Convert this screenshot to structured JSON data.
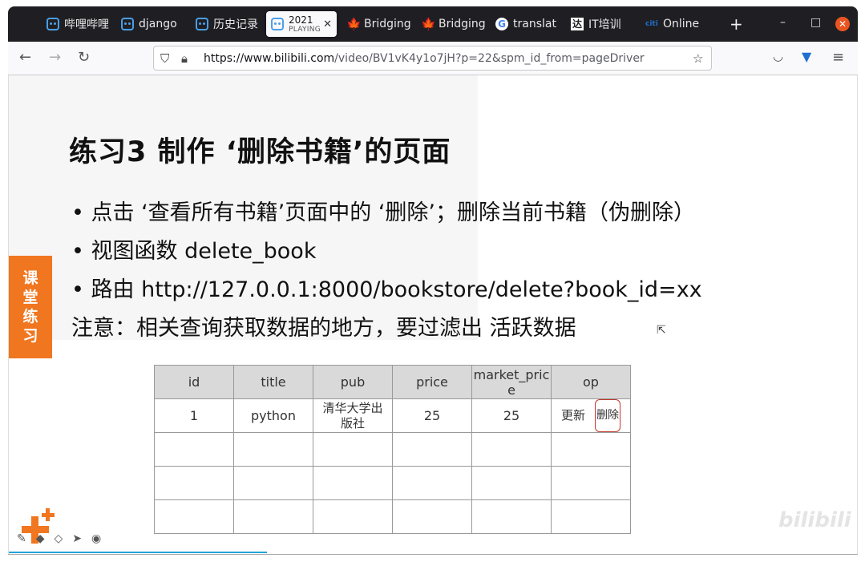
{
  "browser": {
    "tabs": [
      {
        "label": "哔哩哔哩",
        "icon": "bilibili-icon"
      },
      {
        "label": "django",
        "icon": "bilibili-icon"
      },
      {
        "label": "历史记录",
        "icon": "bilibili-icon"
      },
      {
        "label": "2021",
        "sub": "PLAYING",
        "icon": "bilibili-icon",
        "active": true
      },
      {
        "label": "Bridging",
        "icon": "maple-leaf-icon"
      },
      {
        "label": "Bridging",
        "icon": "maple-leaf-icon"
      },
      {
        "label": "translat",
        "icon": "google-icon"
      },
      {
        "label": "IT培训",
        "icon": "it-icon"
      },
      {
        "label": "Online",
        "icon": "citi-icon"
      }
    ],
    "new_tab": "+",
    "window_controls": {
      "minimize": "–",
      "maximize": "□",
      "close": "✕"
    },
    "url_host": "https://www.bilibili.com",
    "url_path": "/video/BV1vK4y1o7jH?p=22&spm_id_from=pageDriver"
  },
  "slide": {
    "title": "练习3 制作 ‘删除书籍’的页面",
    "side_tab": [
      "课",
      "堂",
      "练",
      "习"
    ],
    "bullets": [
      "• 点击 ‘查看所有书籍’页面中的 ‘删除’；删除当前书籍（伪删除）",
      "• 视图函数 delete_book",
      "• 路由 http://127.0.0.1:8000/bookstore/delete?book_id=xx",
      "注意：相关查询获取数据的地方，要过滤出 活跃数据"
    ],
    "table": {
      "headers": [
        "id",
        "title",
        "pub",
        "price",
        "market_price",
        "op"
      ],
      "rows": [
        {
          "id": "1",
          "title": "python",
          "pub": "清华大学出版社",
          "price": "25",
          "market_price": "25",
          "op_update": "更新",
          "op_delete": "删除"
        }
      ]
    },
    "watermark": "bilibili"
  },
  "colors": {
    "accent_orange": "#f0761f",
    "tabbar_bg": "#1f1f23",
    "close_orange": "#e95420",
    "progress_blue": "#23a3d5"
  }
}
